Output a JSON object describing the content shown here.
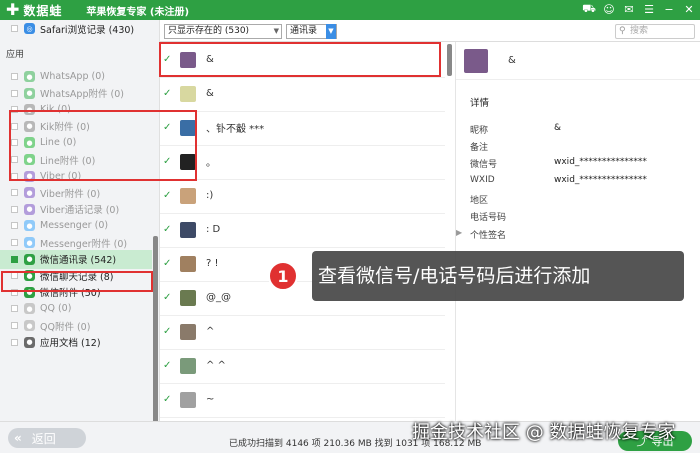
{
  "titlebar": {
    "logo_text": "数据蛙",
    "title": "苹果恢复专家 (未注册)",
    "icons": [
      "cart-icon",
      "user-icon",
      "chat-icon",
      "menu-icon",
      "minimize-icon",
      "close-icon"
    ]
  },
  "sidebar": {
    "top_item": "Safari浏览记录 (430)",
    "heading": "应用",
    "items": [
      {
        "label": "WhatsApp (0)",
        "icon_color": "#8fd19e",
        "checked": false,
        "active": false
      },
      {
        "label": "WhatsApp附件 (0)",
        "icon_color": "#8fd19e",
        "checked": false,
        "active": false
      },
      {
        "label": "Kik (0)",
        "icon_color": "#b8b8b8",
        "checked": false,
        "active": false
      },
      {
        "label": "Kik附件 (0)",
        "icon_color": "#b8b8b8",
        "checked": false,
        "active": false
      },
      {
        "label": "Line (0)",
        "icon_color": "#7fd38b",
        "checked": false,
        "active": false
      },
      {
        "label": "Line附件 (0)",
        "icon_color": "#7fd38b",
        "checked": false,
        "active": false
      },
      {
        "label": "Viber (0)",
        "icon_color": "#b39ddb",
        "checked": false,
        "active": false
      },
      {
        "label": "Viber附件 (0)",
        "icon_color": "#b39ddb",
        "checked": false,
        "active": false
      },
      {
        "label": "Viber通话记录 (0)",
        "icon_color": "#b39ddb",
        "checked": false,
        "active": false
      },
      {
        "label": "Messenger (0)",
        "icon_color": "#90caf9",
        "checked": false,
        "active": false
      },
      {
        "label": "Messenger附件 (0)",
        "icon_color": "#90caf9",
        "checked": false,
        "active": false
      },
      {
        "label": "微信通讯录 (542)",
        "icon_color": "#2ea043",
        "checked": true,
        "active": true,
        "selected": true
      },
      {
        "label": "微信聊天记录 (8)",
        "icon_color": "#2ea043",
        "checked": false,
        "active": true
      },
      {
        "label": "微信附件 (50)",
        "icon_color": "#2ea043",
        "checked": false,
        "active": true
      },
      {
        "label": "QQ (0)",
        "icon_color": "#c8c8c8",
        "checked": false,
        "active": false
      },
      {
        "label": "QQ附件 (0)",
        "icon_color": "#c8c8c8",
        "checked": false,
        "active": false
      },
      {
        "label": "应用文档 (12)",
        "icon_color": "#6b6b6b",
        "checked": false,
        "active": true
      }
    ]
  },
  "toolbar": {
    "filter_value": "只显示存在的 (530)",
    "type_value": "通讯录",
    "search_placeholder": "搜索"
  },
  "contacts": [
    {
      "name": "&",
      "avatar_color": "#7a5a8a"
    },
    {
      "name": "&",
      "avatar_color": "#d8d8a0"
    },
    {
      "name": "、钋不觳 ***",
      "avatar_color": "#3a6ea5"
    },
    {
      "name": "。",
      "avatar_color": "#222222"
    },
    {
      "name": ":)",
      "avatar_color": "#c9a27a"
    },
    {
      "name": ": D",
      "avatar_color": "#3d4a66"
    },
    {
      "name": "? !",
      "avatar_color": "#a08060"
    },
    {
      "name": "@_@",
      "avatar_color": "#6a7a50"
    },
    {
      "name": "^",
      "avatar_color": "#8a7a6a"
    },
    {
      "name": "^ ^",
      "avatar_color": "#7a9a7a"
    },
    {
      "name": "~",
      "avatar_color": "#a0a0a0"
    }
  ],
  "detail": {
    "name": "&",
    "section_title": "详情",
    "fields": [
      {
        "label": "昵称",
        "value": "&"
      },
      {
        "label": "备注",
        "value": ""
      },
      {
        "label": "微信号",
        "value": "wxid_***************"
      },
      {
        "label": "WXID",
        "value": "wxid_***************"
      },
      {
        "label": "地区",
        "value": ""
      },
      {
        "label": "电话号码",
        "value": ""
      },
      {
        "label": "个性签名",
        "value": ""
      }
    ]
  },
  "bottombar": {
    "back_label": "返回",
    "status": "已成功扫描到 4146 项 210.36 MB  找到 1031 项 168.12 MB",
    "export_label": "导出"
  },
  "callout": {
    "number": "1",
    "text": "查看微信号/电话号码后进行添加"
  },
  "watermark": "掘金技术社区 @ 数据蛙恢复专家",
  "colors": {
    "brand": "#2ea043",
    "highlight": "#e03131",
    "selected_bg": "#c9ebd1"
  }
}
